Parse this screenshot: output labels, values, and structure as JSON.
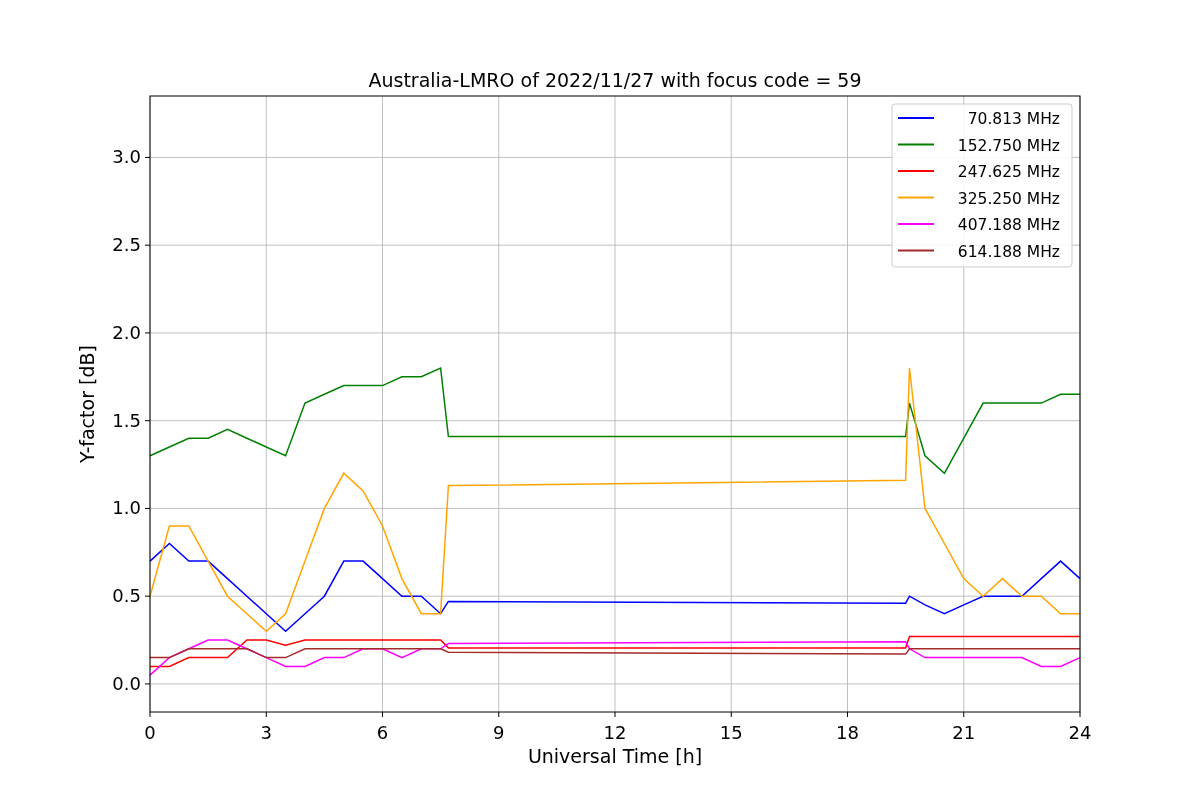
{
  "chart_data": {
    "type": "line",
    "title": "Australia-LMRO of 2022/11/27 with focus code = 59",
    "xlabel": "Universal Time [h]",
    "ylabel": "Y-factor [dB]",
    "x": [
      0,
      0.5,
      1,
      1.5,
      2,
      2.5,
      3,
      3.5,
      4,
      4.5,
      5,
      5.5,
      6,
      6.5,
      7,
      7.5,
      7.7,
      19.5,
      19.6,
      20,
      20.5,
      21,
      21.5,
      22,
      22.5,
      23,
      23.5,
      24
    ],
    "series": [
      {
        "name": "70.813 MHz",
        "color": "#0000ff",
        "values": [
          0.7,
          0.8,
          0.7,
          0.7,
          0.6,
          0.5,
          0.4,
          0.3,
          0.4,
          0.5,
          0.7,
          0.7,
          0.6,
          0.5,
          0.5,
          0.4,
          0.47,
          0.46,
          0.5,
          0.45,
          0.4,
          0.45,
          0.5,
          0.5,
          0.5,
          0.6,
          0.7,
          0.6
        ]
      },
      {
        "name": "152.750 MHz",
        "color": "#008000",
        "values": [
          1.3,
          1.35,
          1.4,
          1.4,
          1.45,
          1.4,
          1.35,
          1.3,
          1.6,
          1.65,
          1.7,
          1.7,
          1.7,
          1.75,
          1.75,
          1.8,
          1.41,
          1.41,
          1.6,
          1.3,
          1.2,
          1.4,
          1.6,
          1.6,
          1.6,
          1.6,
          1.65,
          1.65
        ]
      },
      {
        "name": "247.625 MHz",
        "color": "#ff0000",
        "values": [
          0.1,
          0.1,
          0.15,
          0.15,
          0.15,
          0.25,
          0.25,
          0.22,
          0.25,
          0.25,
          0.25,
          0.25,
          0.25,
          0.25,
          0.25,
          0.25,
          0.205,
          0.205,
          0.27,
          0.27,
          0.27,
          0.27,
          0.27,
          0.27,
          0.27,
          0.27,
          0.27,
          0.27
        ]
      },
      {
        "name": "325.250 MHz",
        "color": "#ffa500",
        "values": [
          0.5,
          0.9,
          0.9,
          0.7,
          0.5,
          0.4,
          0.3,
          0.4,
          0.7,
          1.0,
          1.2,
          1.1,
          0.9,
          0.6,
          0.4,
          0.4,
          1.13,
          1.16,
          1.8,
          1.0,
          0.8,
          0.6,
          0.5,
          0.6,
          0.5,
          0.5,
          0.4,
          0.4
        ]
      },
      {
        "name": "407.188 MHz",
        "color": "#ff00ff",
        "values": [
          0.05,
          0.15,
          0.2,
          0.25,
          0.25,
          0.2,
          0.15,
          0.1,
          0.1,
          0.15,
          0.15,
          0.2,
          0.2,
          0.15,
          0.2,
          0.2,
          0.23,
          0.24,
          0.2,
          0.15,
          0.15,
          0.15,
          0.15,
          0.15,
          0.15,
          0.1,
          0.1,
          0.15
        ]
      },
      {
        "name": "614.188 MHz",
        "color": "#a52a2a",
        "values": [
          0.15,
          0.15,
          0.2,
          0.2,
          0.2,
          0.2,
          0.15,
          0.15,
          0.2,
          0.2,
          0.2,
          0.2,
          0.2,
          0.2,
          0.2,
          0.2,
          0.18,
          0.17,
          0.2,
          0.2,
          0.2,
          0.2,
          0.2,
          0.2,
          0.2,
          0.2,
          0.2,
          0.2
        ]
      }
    ],
    "grid": true,
    "legend": true,
    "xlim": [
      0,
      24
    ],
    "ylim": [
      -0.16,
      3.35
    ],
    "xticks": [
      0,
      3,
      6,
      9,
      12,
      15,
      18,
      21,
      24
    ],
    "yticks": [
      {
        "value": 0,
        "label": "0.0"
      },
      {
        "value": 0.5,
        "label": "0.5"
      },
      {
        "value": 1,
        "label": "1.0"
      },
      {
        "value": 1.5,
        "label": "1.5"
      },
      {
        "value": 2,
        "label": "2.0"
      },
      {
        "value": 2.5,
        "label": "2.5"
      },
      {
        "value": 3,
        "label": "3.0"
      }
    ]
  }
}
